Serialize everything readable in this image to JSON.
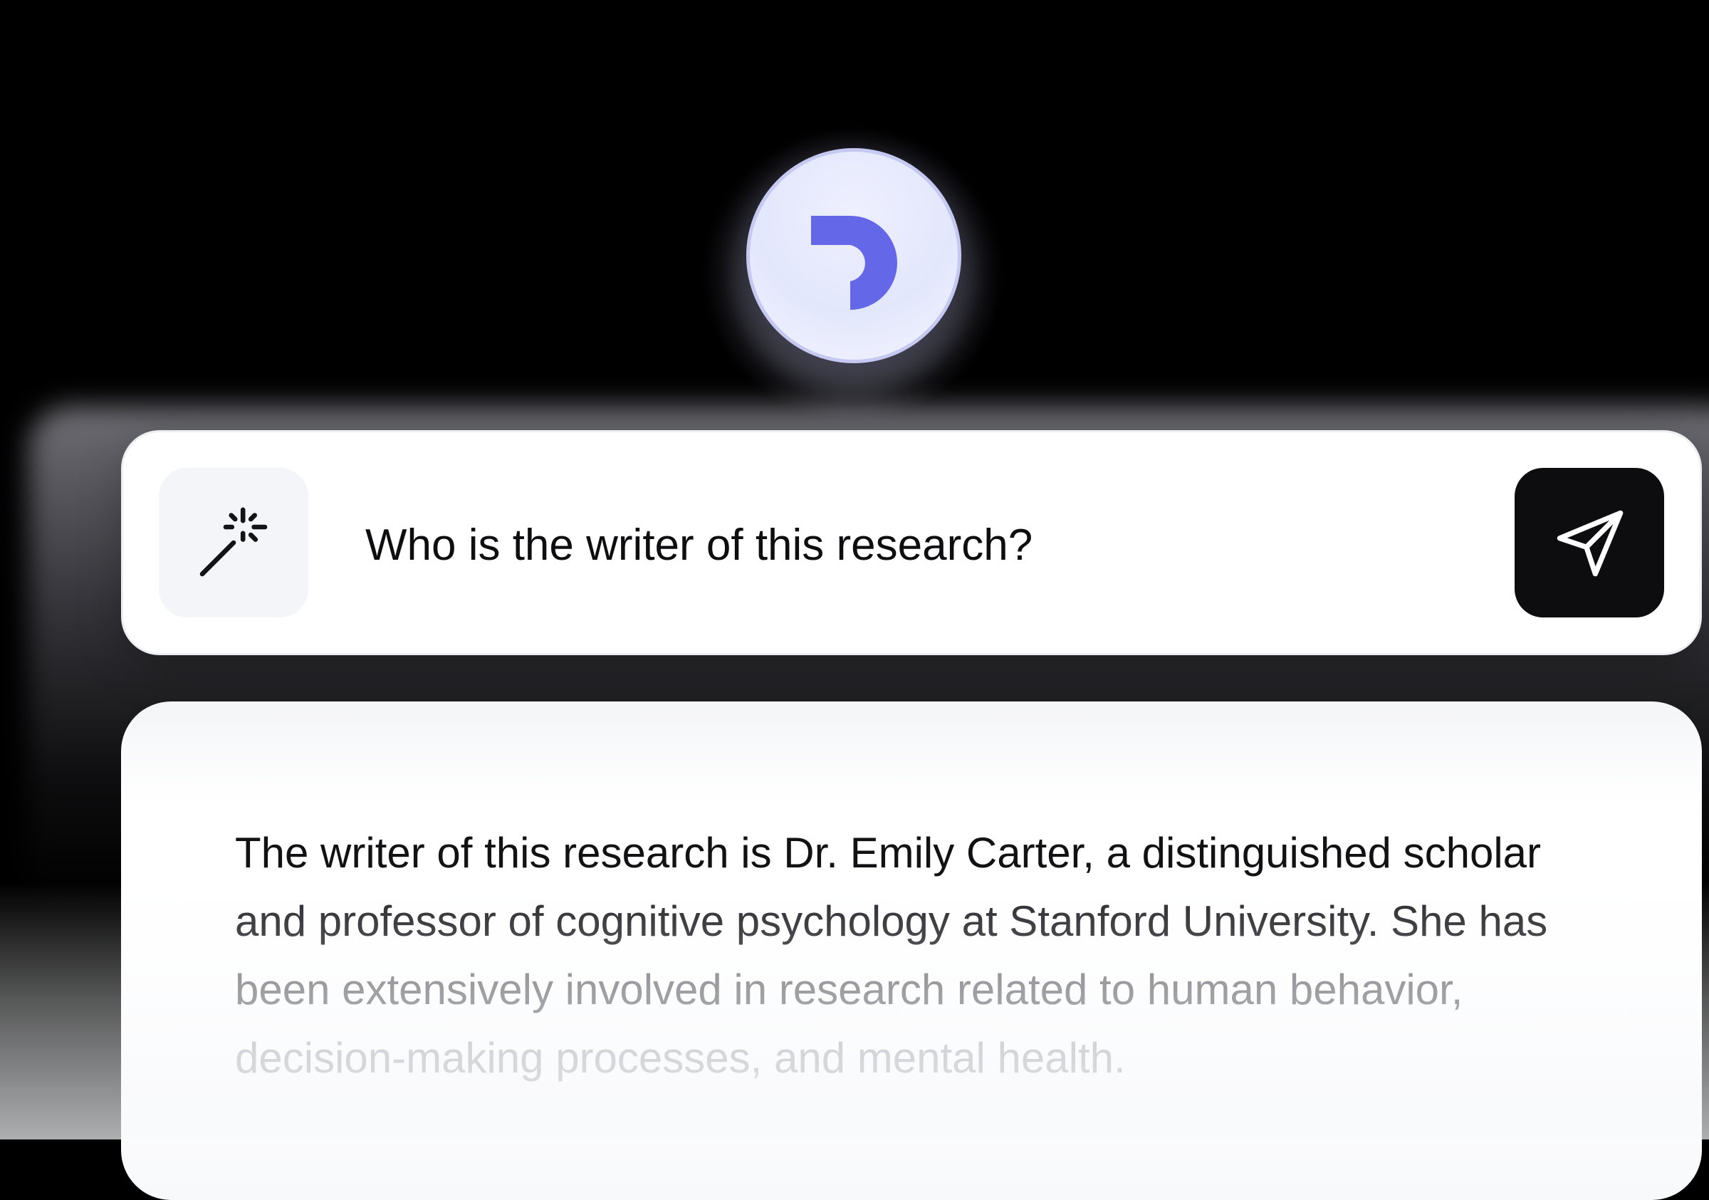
{
  "logo": {
    "icon": "brand-d-icon",
    "accent_color": "#6468e8",
    "ring_color": "#c5c9f2"
  },
  "input_bar": {
    "magic_icon": "magic-wand-icon",
    "query_value": "Who is the writer of this research?",
    "send_icon": "send-icon",
    "send_button_color": "#0d0d10"
  },
  "answer": {
    "lines": [
      "The writer of this research is Dr. Emily Carter, a distinguished scholar",
      "and professor of cognitive psychology at Stanford University. She has",
      "been extensively involved in research related to human behavior,",
      "decision-making processes, and mental health."
    ]
  }
}
